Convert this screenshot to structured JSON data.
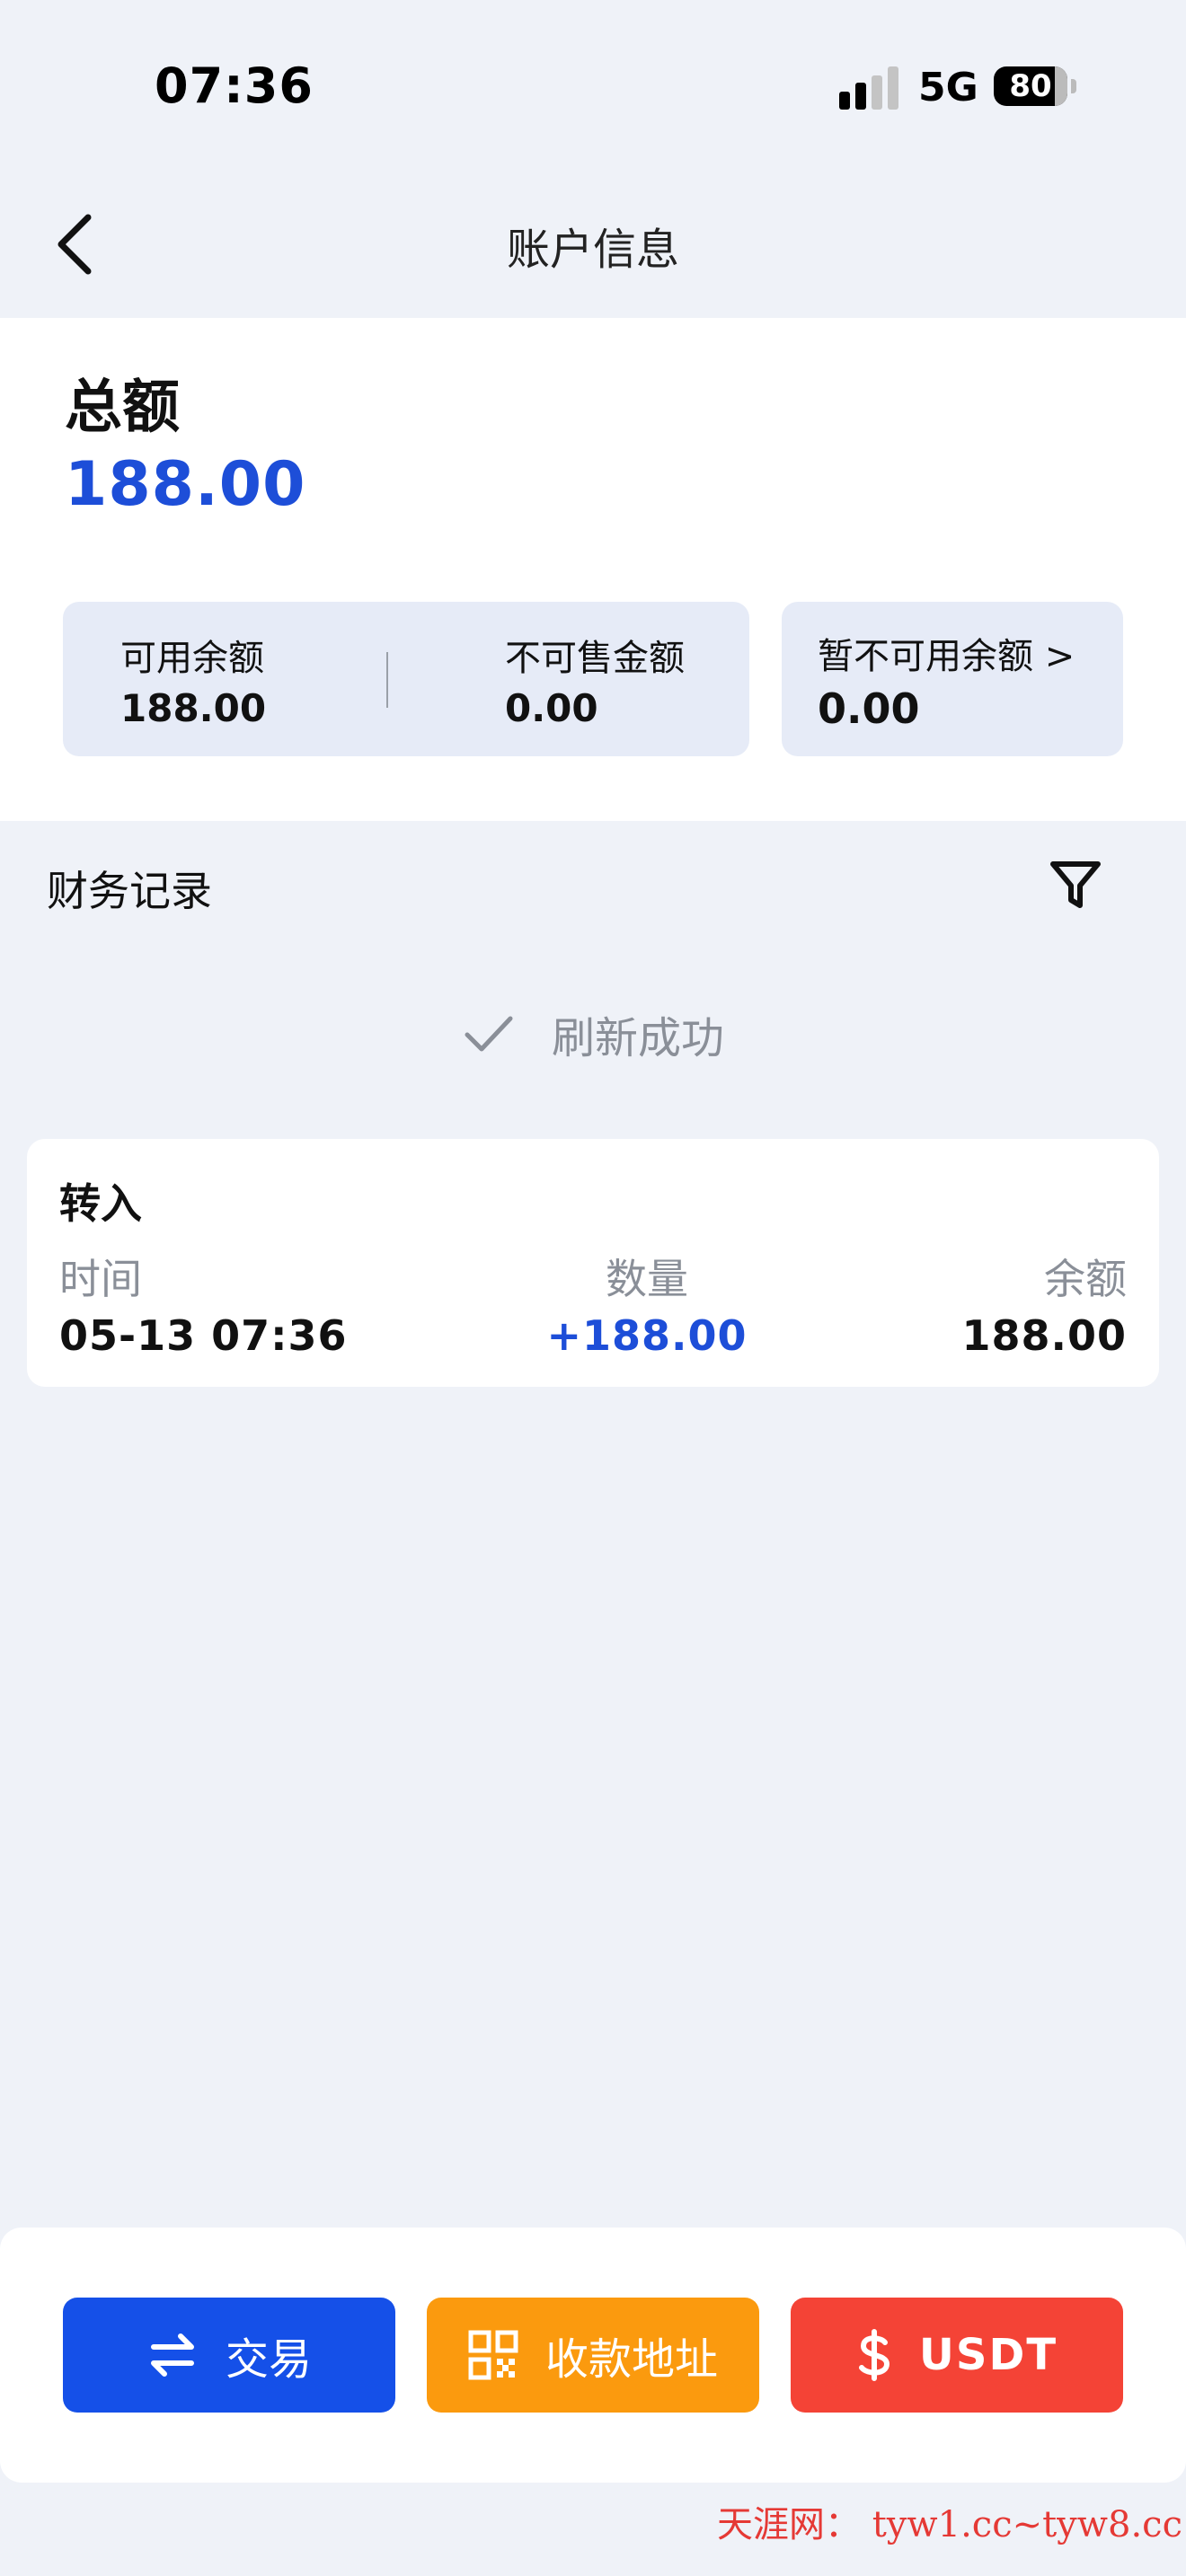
{
  "status_bar": {
    "time": "07:36",
    "network": "5G",
    "battery": "80"
  },
  "nav": {
    "title": "账户信息"
  },
  "summary": {
    "total_label": "总额",
    "total_value": "188.00",
    "available_label": "可用余额",
    "available_value": "188.00",
    "unsellable_label": "不可售金额",
    "unsellable_value": "0.00",
    "unavailable_label": "暂不可用余额 >",
    "unavailable_value": "0.00"
  },
  "records": {
    "title": "财务记录",
    "refresh_text": "刷新成功",
    "items": [
      {
        "type": "转入",
        "time_label": "时间",
        "time": "05-13 07:36",
        "amount_label": "数量",
        "amount": "+188.00",
        "balance_label": "余额",
        "balance": "188.00"
      }
    ]
  },
  "actions": {
    "trade": "交易",
    "address": "收款地址",
    "usdt": "USDT"
  },
  "colors": {
    "accent": "#1d4ed8",
    "trade": "#1550e8",
    "address": "#fb9a0e",
    "usdt": "#f44336"
  },
  "watermark": "天涯网： tyw1.cc~tyw8.cc"
}
